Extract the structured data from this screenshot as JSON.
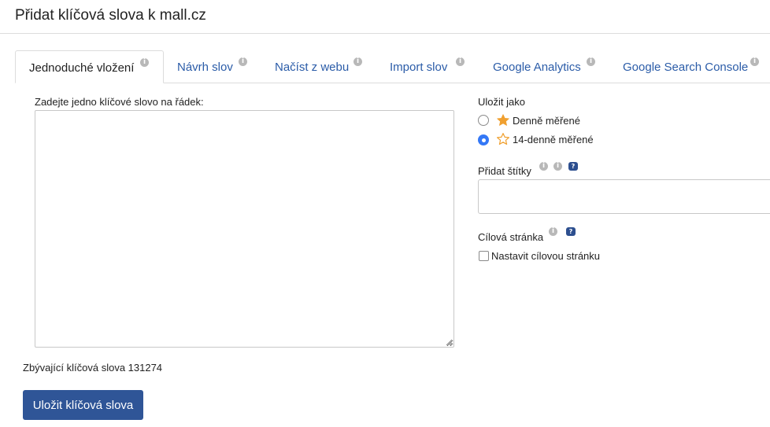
{
  "header": {
    "title": "Přidat klíčová slova k mall.cz"
  },
  "tabs": [
    {
      "label": "Jednoduché vložení",
      "active": true
    },
    {
      "label": "Návrh slov",
      "active": false
    },
    {
      "label": "Načíst z webu",
      "active": false
    },
    {
      "label": "Import slov",
      "active": false
    },
    {
      "label": "Google Analytics",
      "active": false
    },
    {
      "label": "Google Search Console",
      "active": false
    }
  ],
  "icons": {
    "info": "i",
    "help": "?"
  },
  "keywords": {
    "label": "Zadejte jedno klíčové slovo na řádek:",
    "value": "",
    "remaining": "Zbývající klíčová slova 131274"
  },
  "save_as": {
    "label": "Uložit jako",
    "options": [
      {
        "label": "Denně měřené",
        "selected": false,
        "icon": "star-filled-icon"
      },
      {
        "label": "14-denně měřené",
        "selected": true,
        "icon": "star-outline-icon"
      }
    ]
  },
  "tags": {
    "label": "Přidat štítky",
    "value": ""
  },
  "target_page": {
    "label": "Cílová stránka",
    "checkbox_label": "Nastavit cílovou stránku",
    "checked": false
  },
  "save_button": {
    "label": "Uložit klíčová slova"
  },
  "colors": {
    "accent": "#2f5597",
    "link": "#2b5ca8",
    "radio": "#3478f6",
    "star": "#f0a030"
  }
}
